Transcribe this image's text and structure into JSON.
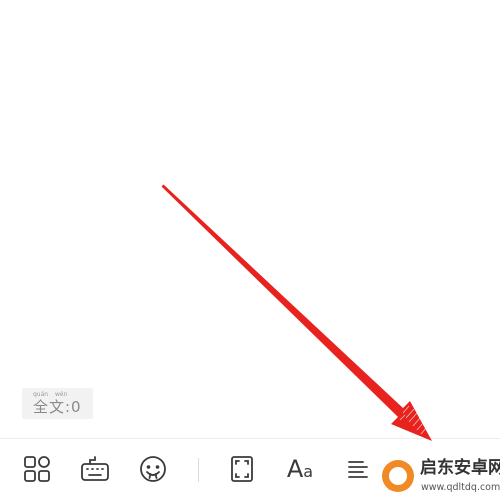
{
  "word_count": {
    "pinyin": [
      "quán",
      "wén"
    ],
    "label": "全文:0"
  },
  "toolbar": {
    "buttons": [
      {
        "name": "template-button",
        "icon": "grid-icon"
      },
      {
        "name": "keyboard-button",
        "icon": "keyboard-icon"
      },
      {
        "name": "emoji-button",
        "icon": "emoji-face-icon"
      },
      {
        "name": "fullscreen-button",
        "icon": "frame-corners-icon"
      },
      {
        "name": "font-button",
        "icon": "font-size-icon",
        "label_big": "A",
        "label_small": "a"
      },
      {
        "name": "align-button",
        "icon": "align-left-icon"
      }
    ]
  },
  "annotation": {
    "type": "arrow",
    "color": "#e8231f",
    "points_to": "toolbar bottom-right"
  },
  "watermark": {
    "title": "启东安卓网",
    "url": "www.qdltdq.com",
    "logo_color": "#f08a24"
  },
  "colors": {
    "icon": "#3a3a3a",
    "word_count_bg": "#f2f2f2",
    "word_count_text": "#8a8a8a"
  }
}
